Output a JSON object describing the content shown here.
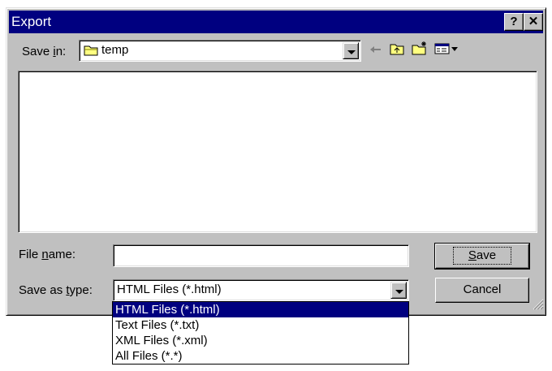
{
  "window": {
    "title": "Export",
    "help_label": "?",
    "close_label": "✕"
  },
  "save_in": {
    "label_prefix": "Save ",
    "label_accel": "i",
    "label_suffix": "n:",
    "value": "temp"
  },
  "toolbar": {
    "back_icon": "back-arrow-icon",
    "up_icon": "up-folder-icon",
    "new_folder_icon": "new-folder-icon",
    "view_icon": "view-menu-icon"
  },
  "file_name": {
    "label_prefix": "File ",
    "label_accel": "n",
    "label_suffix": "ame:",
    "value": ""
  },
  "save_type": {
    "label_prefix": "Save as ",
    "label_accel": "t",
    "label_suffix": "ype:",
    "value": "HTML Files (*.html)",
    "options": [
      "HTML Files (*.html)",
      "Text Files (*.txt)",
      "XML Files (*.xml)",
      "All Files (*.*)"
    ]
  },
  "buttons": {
    "save_accel": "S",
    "save_rest": "ave",
    "cancel": "Cancel"
  },
  "colors": {
    "title_bar": "#000080",
    "face": "#c0c0c0",
    "selection": "#000080"
  }
}
